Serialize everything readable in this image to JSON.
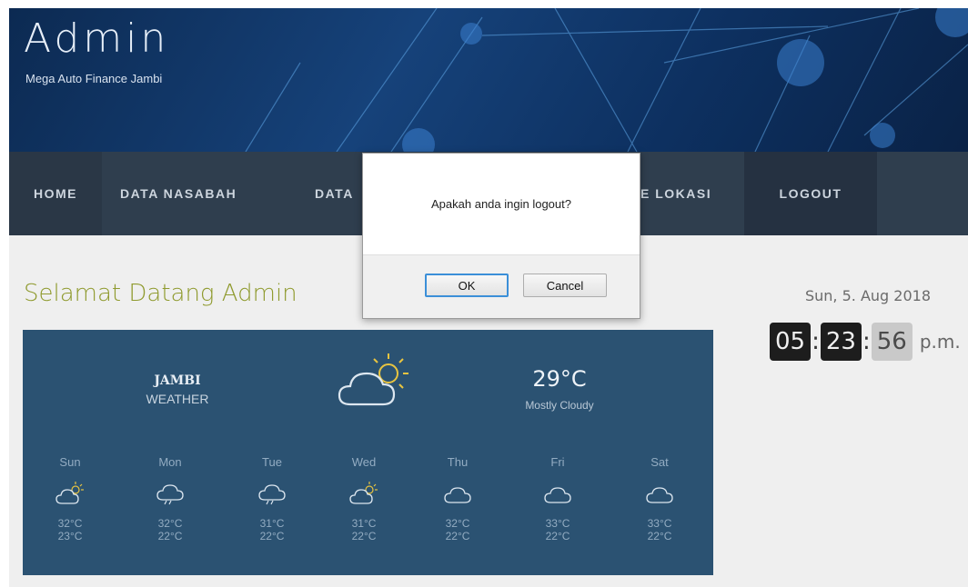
{
  "header": {
    "title": "Admin",
    "subtitle": "Mega Auto Finance Jambi"
  },
  "nav": {
    "items": [
      {
        "label": "HOME"
      },
      {
        "label": "DATA NASABAH"
      },
      {
        "label": "DATA"
      },
      {
        "label": "E LOKASI"
      },
      {
        "label": "LOGOUT"
      }
    ]
  },
  "welcome": "Selamat Datang Admin",
  "weather": {
    "city": "JAMBI",
    "label": "WEATHER",
    "current_icon": "cloud-sun-icon",
    "current_temp": "29°C",
    "condition": "Mostly Cloudy",
    "forecast": [
      {
        "day": "Sun",
        "icon": "cloud-sun-icon",
        "hi": "32°C",
        "lo": "23°C"
      },
      {
        "day": "Mon",
        "icon": "cloud-rain-icon",
        "hi": "32°C",
        "lo": "22°C"
      },
      {
        "day": "Tue",
        "icon": "cloud-rain-icon",
        "hi": "31°C",
        "lo": "22°C"
      },
      {
        "day": "Wed",
        "icon": "cloud-sun-icon",
        "hi": "31°C",
        "lo": "22°C"
      },
      {
        "day": "Thu",
        "icon": "cloud-icon",
        "hi": "32°C",
        "lo": "22°C"
      },
      {
        "day": "Fri",
        "icon": "cloud-icon",
        "hi": "33°C",
        "lo": "22°C"
      },
      {
        "day": "Sat",
        "icon": "cloud-icon",
        "hi": "33°C",
        "lo": "22°C"
      }
    ]
  },
  "clock": {
    "date": "Sun, 5. Aug 2018",
    "hours": "05",
    "minutes": "23",
    "seconds": "56",
    "ampm": "p.m."
  },
  "dialog": {
    "message": "Apakah anda ingin logout?",
    "ok_label": "OK",
    "cancel_label": "Cancel"
  },
  "colors": {
    "header_bg": "#16427a",
    "nav_bg": "#2f3e4e",
    "welcome_text": "#8f9a2e",
    "weather_bg": "#2b5272",
    "accent_sun": "#e8c440"
  }
}
